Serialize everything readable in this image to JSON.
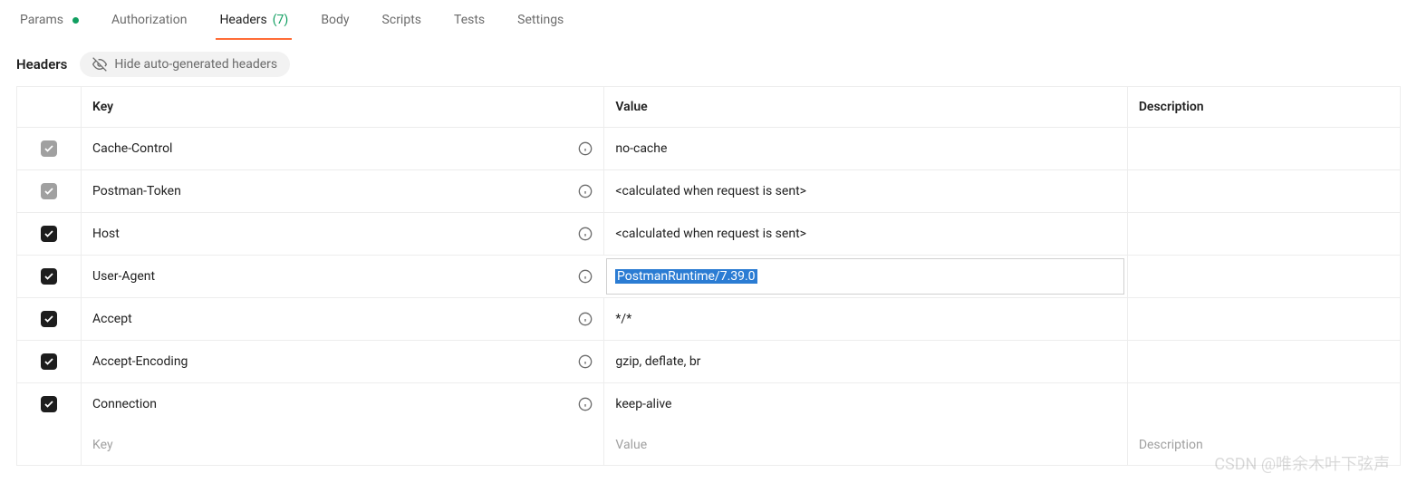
{
  "tabs": [
    {
      "label": "Params",
      "has_dot": true
    },
    {
      "label": "Authorization"
    },
    {
      "label": "Headers",
      "count": "(7)",
      "active": true
    },
    {
      "label": "Body"
    },
    {
      "label": "Scripts"
    },
    {
      "label": "Tests"
    },
    {
      "label": "Settings"
    }
  ],
  "subheader": {
    "title": "Headers",
    "hide_button": "Hide auto-generated headers"
  },
  "columns": {
    "key": "Key",
    "value": "Value",
    "description": "Description"
  },
  "rows": [
    {
      "checked": true,
      "disabled": true,
      "key": "Cache-Control",
      "value": "no-cache",
      "info": true
    },
    {
      "checked": true,
      "disabled": true,
      "key": "Postman-Token",
      "value": "<calculated when request is sent>",
      "info": true
    },
    {
      "checked": true,
      "disabled": false,
      "key": "Host",
      "value": "<calculated when request is sent>",
      "info": true
    },
    {
      "checked": true,
      "disabled": false,
      "key": "User-Agent",
      "value": "PostmanRuntime/7.39.0",
      "info": true,
      "editing": true
    },
    {
      "checked": true,
      "disabled": false,
      "key": "Accept",
      "value": "*/*",
      "info": true
    },
    {
      "checked": true,
      "disabled": false,
      "key": "Accept-Encoding",
      "value": "gzip, deflate, br",
      "info": true
    },
    {
      "checked": true,
      "disabled": false,
      "key": "Connection",
      "value": "keep-alive",
      "info": true
    }
  ],
  "placeholders": {
    "key": "Key",
    "value": "Value",
    "description": "Description"
  },
  "watermark": "CSDN @唯余木叶下弦声"
}
